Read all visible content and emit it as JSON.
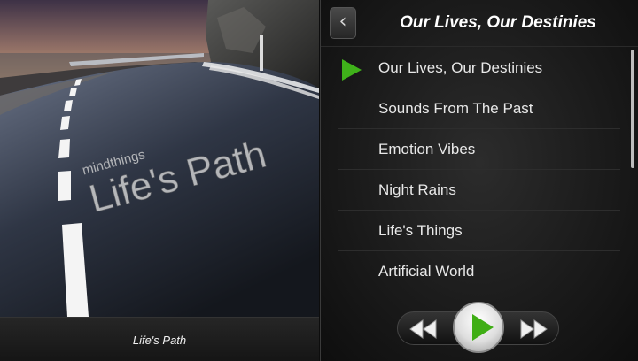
{
  "album": {
    "art_brand": "mindthings",
    "art_title": "Life's Path",
    "caption": "Life's Path"
  },
  "header": {
    "back_icon": "chevron-left-icon",
    "title": "Our Lives, Our Destinies"
  },
  "playlist": {
    "now_playing_index": 0,
    "tracks": [
      {
        "title": "Our Lives, Our Destinies"
      },
      {
        "title": "Sounds From The Past"
      },
      {
        "title": "Emotion Vibes"
      },
      {
        "title": "Night Rains"
      },
      {
        "title": "Life's Things"
      },
      {
        "title": "Artificial World"
      }
    ]
  },
  "controls": {
    "rewind_icon": "rewind-icon",
    "play_icon": "play-icon",
    "fast_forward_icon": "fast-forward-icon"
  },
  "colors": {
    "accent_green": "#3fb11a",
    "background": "#1b1b1b",
    "text": "#e8e8e8"
  }
}
